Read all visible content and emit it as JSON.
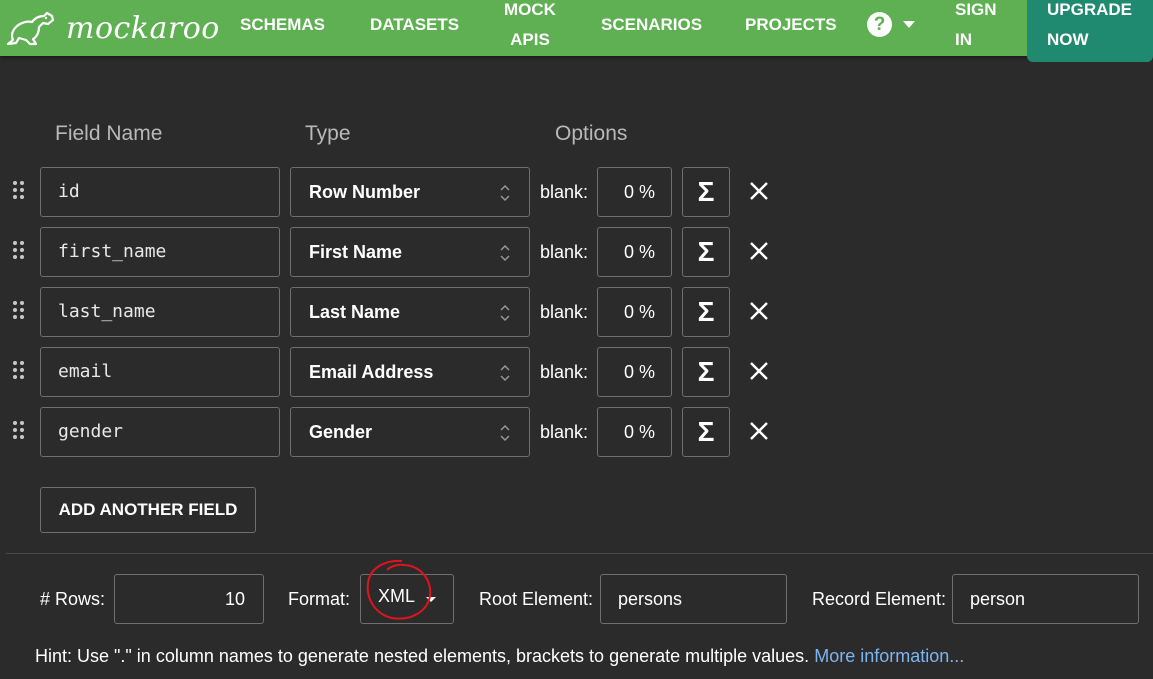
{
  "header": {
    "logo_text": "mockaroo",
    "logo_icon": "kangaroo-icon",
    "nav": {
      "schemas": "SCHEMAS",
      "datasets": "DATASETS",
      "mock_apis_line1": "MOCK",
      "mock_apis_line2": "APIS",
      "scenarios": "SCENARIOS",
      "projects": "PROJECTS",
      "sign_in_line1": "SIGN",
      "sign_in_line2": "IN"
    },
    "help_symbol": "?",
    "upgrade_line1": "UPGRADE",
    "upgrade_line2": "NOW"
  },
  "columns": {
    "field_name": "Field Name",
    "type": "Type",
    "options": "Options"
  },
  "fields": [
    {
      "name": "id",
      "type": "Row Number",
      "blank_label": "blank:",
      "blank_pct": "0 %",
      "sigma": "Σ"
    },
    {
      "name": "first_name",
      "type": "First Name",
      "blank_label": "blank:",
      "blank_pct": "0 %",
      "sigma": "Σ"
    },
    {
      "name": "last_name",
      "type": "Last Name",
      "blank_label": "blank:",
      "blank_pct": "0 %",
      "sigma": "Σ"
    },
    {
      "name": "email",
      "type": "Email Address",
      "blank_label": "blank:",
      "blank_pct": "0 %",
      "sigma": "Σ"
    },
    {
      "name": "gender",
      "type": "Gender",
      "blank_label": "blank:",
      "blank_pct": "0 %",
      "sigma": "Σ"
    }
  ],
  "add_field_label": "ADD ANOTHER FIELD",
  "settings": {
    "rows_label": "# Rows:",
    "rows_value": "10",
    "format_label": "Format:",
    "format_value": "XML",
    "root_label": "Root Element:",
    "root_value": "persons",
    "record_label": "Record Element:",
    "record_value": "person"
  },
  "hint": {
    "text": "Hint: Use \".\" in column names to generate nested elements, brackets to generate multiple values.",
    "link": "More information..."
  },
  "colors": {
    "header_green": "#5fb052",
    "upgrade_teal": "#1f8a70",
    "background": "#2b2b2b",
    "link_blue": "#7db5f0",
    "annotation_red": "#e0141e"
  }
}
